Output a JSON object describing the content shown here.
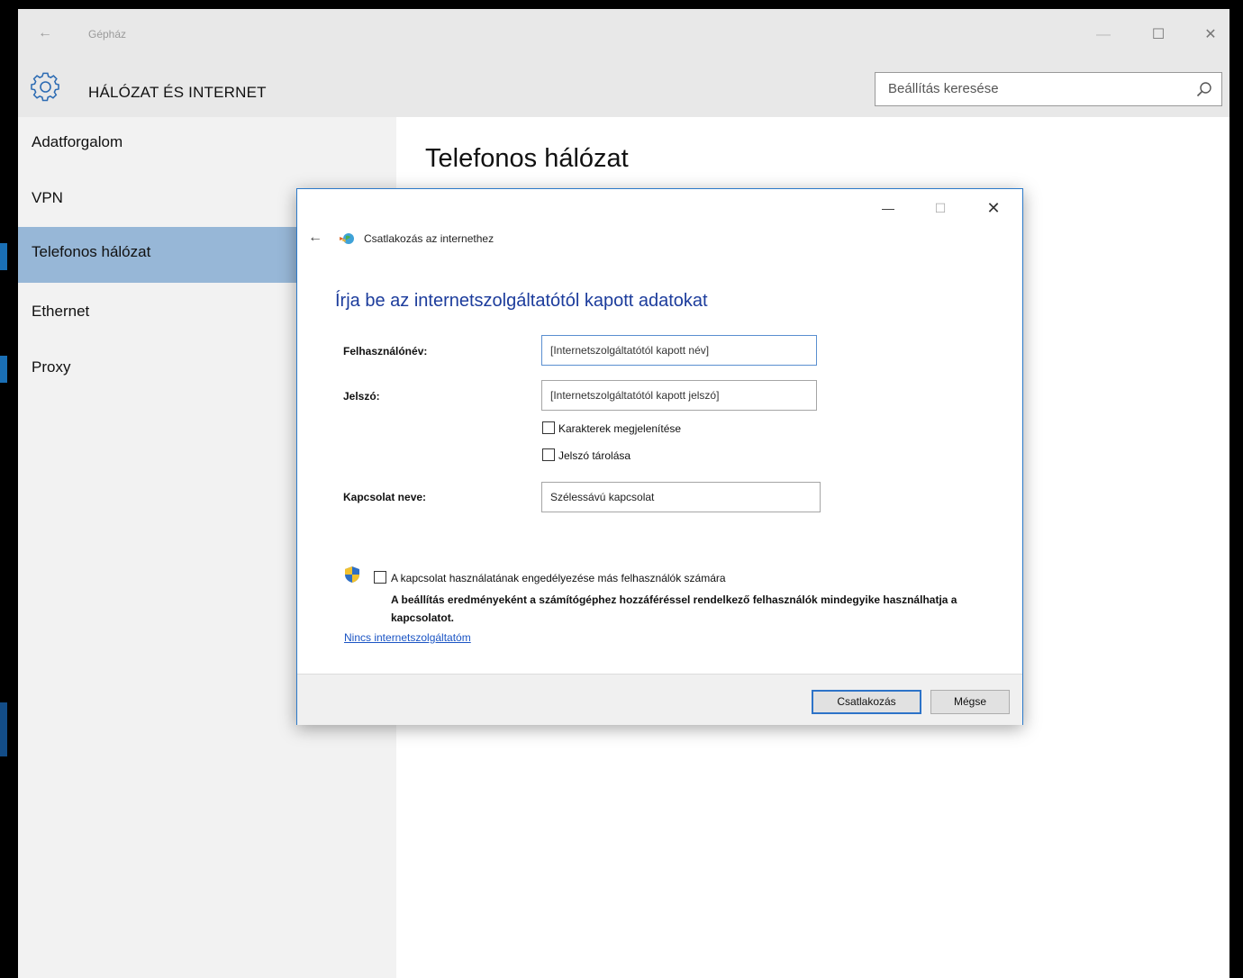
{
  "window": {
    "title": "Gépház",
    "back_glyph": "←",
    "controls": {
      "minimize": "—",
      "maximize": "☐",
      "close": "✕"
    }
  },
  "header": {
    "section_title": "HÁLÓZAT ÉS INTERNET",
    "search_placeholder": "Beállítás keresése",
    "icons": [
      "gear-icon",
      "search-icon"
    ]
  },
  "sidebar": {
    "items": [
      {
        "label": "Adatforgalom",
        "active": false
      },
      {
        "label": "VPN",
        "active": false
      },
      {
        "label": "Telefonos hálózat",
        "active": true
      },
      {
        "label": "Ethernet",
        "active": false
      },
      {
        "label": "Proxy",
        "active": false
      }
    ]
  },
  "main": {
    "page_title": "Telefonos hálózat"
  },
  "dialog": {
    "controls": {
      "minimize": "—",
      "maximize": "☐",
      "close": "✕"
    },
    "nav_back": "←",
    "nav_title": "Csatlakozás az internethez",
    "heading": "Írja be az internetszolgáltatótól kapott adatokat",
    "username_label": "Felhasználónév:",
    "username_placeholder": "[Internetszolgáltatótól kapott név]",
    "password_label": "Jelszó:",
    "password_placeholder": "[Internetszolgáltatótól kapott jelszó]",
    "show_chars_label": "Karakterek megjelenítése",
    "show_chars_checked": false,
    "remember_label": "Jelszó tárolása",
    "remember_checked": false,
    "connection_name_label": "Kapcsolat neve:",
    "connection_name_value": "Szélessávú kapcsolat",
    "allow_others_label": "A kapcsolat használatának engedélyezése más felhasználók számára",
    "allow_others_checked": false,
    "allow_others_desc": "A beállítás eredményeként a számítógéphez hozzáféréssel rendelkező felhasználók mindegyike használhatja a kapcsolatot.",
    "no_isp_link": "Nincs internetszolgáltatóm",
    "connect_button": "Csatlakozás",
    "cancel_button": "Mégse"
  },
  "colors": {
    "accent": "#97b7d7",
    "heading_blue": "#1c3c9c",
    "link_blue": "#1a54c4",
    "dialog_border": "#2b79c9"
  }
}
